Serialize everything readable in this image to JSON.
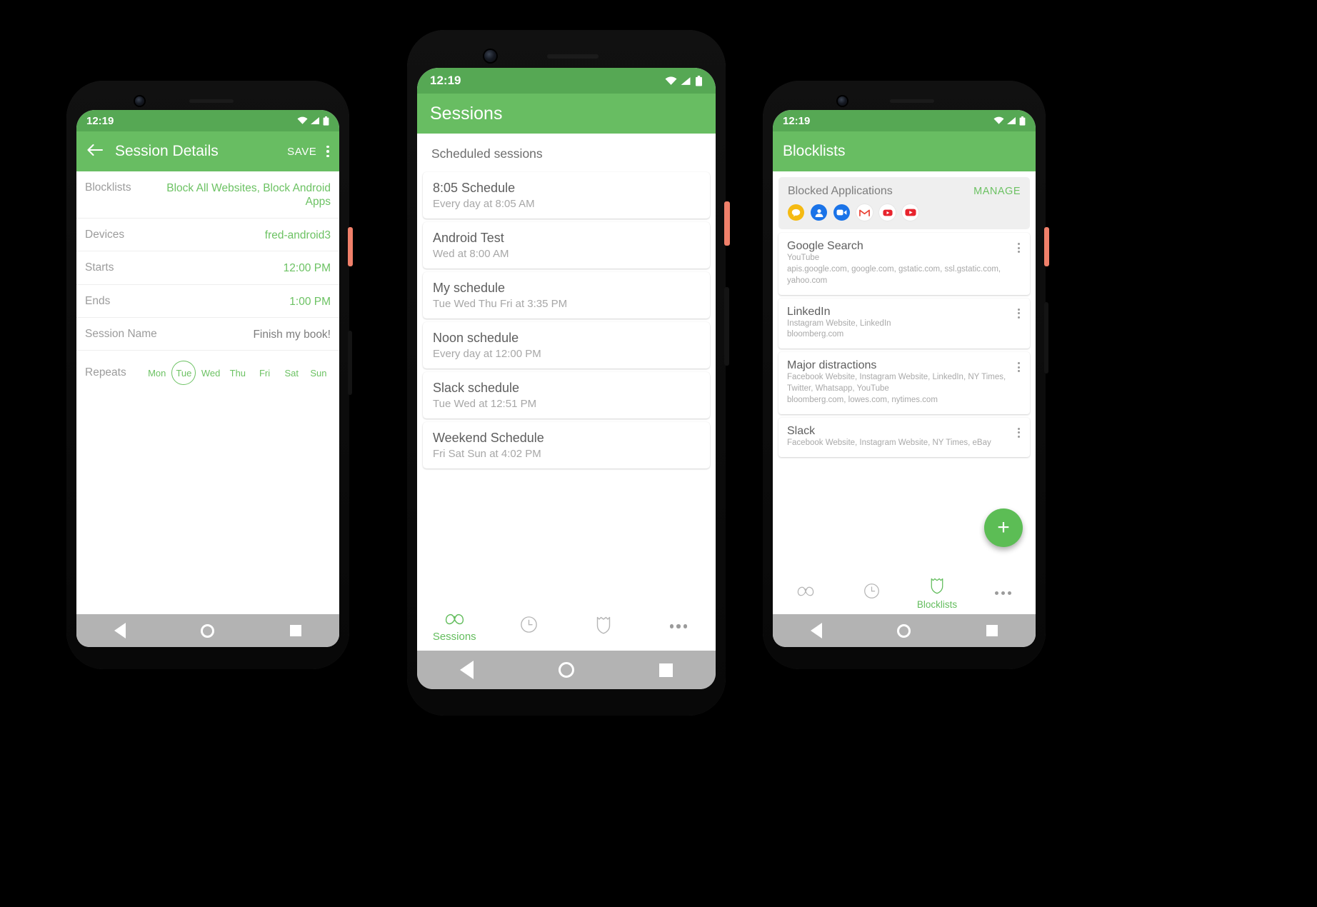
{
  "theme": {
    "green": "#68bd62",
    "green_dark": "#56a854",
    "accent_text": "#6cc263",
    "fab": "#5cbd55"
  },
  "status_bar": {
    "time": "12:19"
  },
  "phone_left": {
    "appbar": {
      "title": "Session Details",
      "save_label": "SAVE"
    },
    "rows": [
      {
        "label": "Blocklists",
        "value": "Block All Websites, Block Android Apps",
        "accent": true
      },
      {
        "label": "Devices",
        "value": "fred-android3",
        "accent": true
      },
      {
        "label": "Starts",
        "value": "12:00 PM",
        "accent": true
      },
      {
        "label": "Ends",
        "value": "1:00 PM",
        "accent": true
      },
      {
        "label": "Session Name",
        "value": "Finish my book!",
        "accent": false
      }
    ],
    "repeats": {
      "label": "Repeats",
      "days": [
        {
          "name": "Mon",
          "selected": false
        },
        {
          "name": "Tue",
          "selected": true
        },
        {
          "name": "Wed",
          "selected": false
        },
        {
          "name": "Thu",
          "selected": false
        },
        {
          "name": "Fri",
          "selected": false
        },
        {
          "name": "Sat",
          "selected": false
        },
        {
          "name": "Sun",
          "selected": false
        }
      ]
    }
  },
  "phone_mid": {
    "appbar": {
      "title": "Sessions"
    },
    "section_header": "Scheduled sessions",
    "sessions": [
      {
        "title": "8:05 Schedule",
        "schedule": "Every day at 8:05 AM"
      },
      {
        "title": "Android Test",
        "schedule": "Wed at 8:00 AM"
      },
      {
        "title": "My schedule",
        "schedule": "Tue Wed Thu Fri at 3:35 PM"
      },
      {
        "title": "Noon schedule",
        "schedule": "Every day at 12:00 PM"
      },
      {
        "title": "Slack schedule",
        "schedule": "Tue Wed at 12:51 PM"
      },
      {
        "title": "Weekend Schedule",
        "schedule": "Fri Sat Sun at 4:02 PM"
      }
    ],
    "tabs": [
      {
        "label": "Sessions",
        "icon": "butterfly-icon",
        "active": true
      },
      {
        "label": "",
        "icon": "clock-icon",
        "active": false
      },
      {
        "label": "",
        "icon": "shield-icon",
        "active": false
      },
      {
        "label": "",
        "icon": "more-icon",
        "active": false
      }
    ]
  },
  "phone_right": {
    "appbar": {
      "title": "Blocklists"
    },
    "blocked_apps": {
      "title": "Blocked Applications",
      "manage_label": "MANAGE",
      "icons": [
        {
          "name": "kakaotalk-icon",
          "color": "#f5ba12"
        },
        {
          "name": "contacts-icon",
          "color": "#1a73e8"
        },
        {
          "name": "duo-icon",
          "color": "#1a73e8"
        },
        {
          "name": "gmail-icon",
          "color": "#ea4335"
        },
        {
          "name": "youtube-music-icon",
          "color": "#e8242d"
        },
        {
          "name": "youtube-icon",
          "color": "#e8242d"
        }
      ]
    },
    "blocklists": [
      {
        "title": "Google Search",
        "lines": [
          "YouTube",
          "apis.google.com, google.com, gstatic.com, ssl.gstatic.com, yahoo.com"
        ]
      },
      {
        "title": "LinkedIn",
        "lines": [
          "Instagram Website, LinkedIn",
          "bloomberg.com"
        ]
      },
      {
        "title": "Major distractions",
        "lines": [
          "Facebook Website, Instagram Website, LinkedIn, NY Times, Twitter, Whatsapp, YouTube",
          "bloomberg.com, lowes.com, nytimes.com"
        ]
      },
      {
        "title": "Slack",
        "lines": [
          "Facebook Website, Instagram Website, NY Times, eBay"
        ]
      }
    ],
    "fab_label": "+",
    "tabs": [
      {
        "label": "",
        "icon": "butterfly-icon",
        "active": false
      },
      {
        "label": "",
        "icon": "clock-icon",
        "active": false
      },
      {
        "label": "Blocklists",
        "icon": "shield-icon",
        "active": true
      },
      {
        "label": "",
        "icon": "more-icon",
        "active": false
      }
    ]
  }
}
